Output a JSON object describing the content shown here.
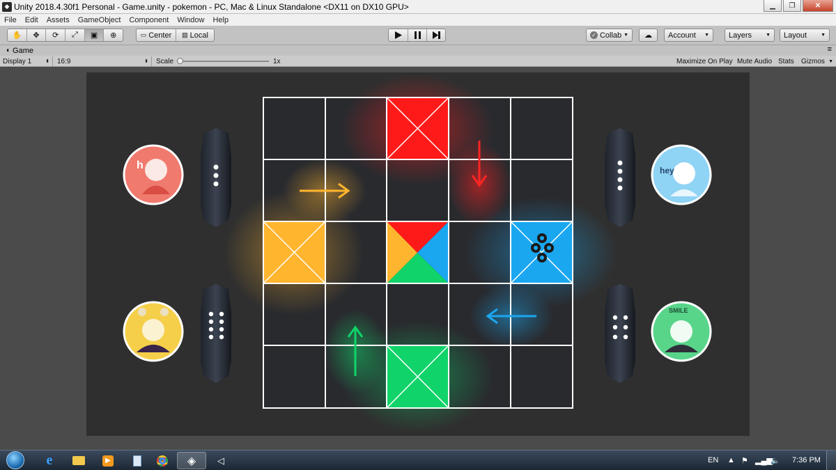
{
  "window": {
    "title": "Unity 2018.4.30f1 Personal - Game.unity - pokemon - PC, Mac & Linux Standalone <DX11 on DX10 GPU>"
  },
  "menu": [
    "File",
    "Edit",
    "Assets",
    "GameObject",
    "Component",
    "Window",
    "Help"
  ],
  "toolbar": {
    "pivot_label": "Center",
    "space_label": "Local",
    "collab_label": "Collab",
    "account_label": "Account",
    "layers_label": "Layers",
    "layout_label": "Layout"
  },
  "game_tab": {
    "label": "Game"
  },
  "game_bar": {
    "display": "Display 1",
    "aspect": "16:9",
    "scale_label": "Scale",
    "scale_value": "1x",
    "maximize": "Maximize On Play",
    "mute": "Mute Audio",
    "stats": "Stats",
    "gizmos": "Gizmos"
  },
  "players": [
    {
      "name": "player-red",
      "caption": "hi",
      "color": "#f07a6e",
      "dice_pips": 3
    },
    {
      "name": "player-blue",
      "caption": "hey",
      "color": "#8fd3f5",
      "dice_pips": 4
    },
    {
      "name": "player-yellow",
      "caption": "hi",
      "color": "#f5cf4a",
      "dice_pips": 8
    },
    {
      "name": "player-green",
      "caption": "SMILE",
      "color": "#59d58a",
      "dice_pips": 6
    }
  ],
  "board": {
    "colors": {
      "red": "#ff1a1a",
      "blue": "#1aa7f0",
      "yellow": "#ffb52e",
      "green": "#10d36a"
    }
  },
  "taskbar": {
    "language": "EN",
    "time": "7:36 PM"
  }
}
